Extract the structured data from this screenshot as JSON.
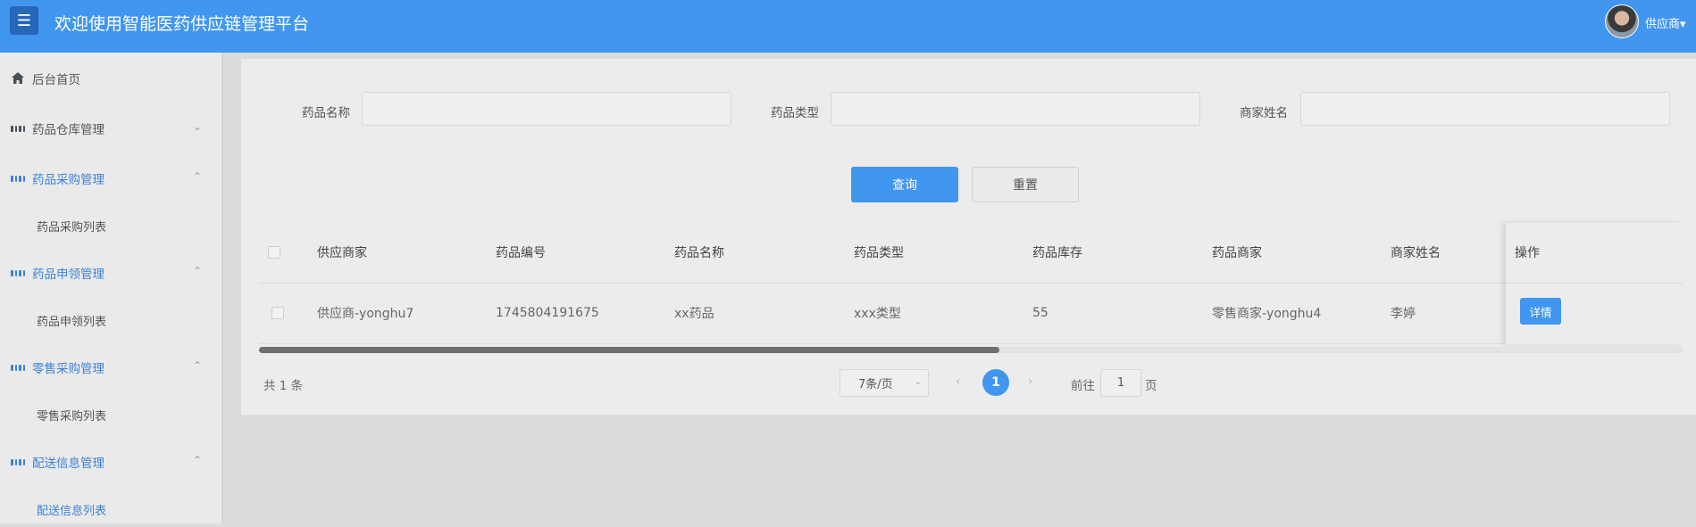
{
  "header": {
    "menu_icon": "hamburger-icon",
    "title": "欢迎使用智能医药供应链管理平台",
    "user_name": "供应商",
    "user_chevron": "▾",
    "menu_glyph": "☰"
  },
  "sidebar": {
    "items": [
      {
        "label": "后台首页",
        "icon": "home-icon"
      },
      {
        "label": "药品仓库管理",
        "icon": "grid-icon",
        "chevron": "⌄"
      },
      {
        "label": "药品采购管理",
        "icon": "grid-icon",
        "chevron": "⌃"
      },
      {
        "label": "药品采购列表"
      },
      {
        "label": "药品申领管理",
        "icon": "grid-icon",
        "chevron": "⌃"
      },
      {
        "label": "药品申领列表"
      },
      {
        "label": "零售采购管理",
        "icon": "grid-icon",
        "chevron": "⌃"
      },
      {
        "label": "零售采购列表"
      },
      {
        "label": "配送信息管理",
        "icon": "grid-icon",
        "chevron": "⌃"
      },
      {
        "label": "配送信息列表"
      }
    ]
  },
  "search": {
    "fields": [
      {
        "label": "药品名称",
        "value": "",
        "placeholder": ""
      },
      {
        "label": "药品类型",
        "value": "",
        "placeholder": ""
      },
      {
        "label": "商家姓名",
        "value": "",
        "placeholder": ""
      }
    ],
    "query_label": "查询",
    "reset_label": "重置"
  },
  "table": {
    "columns": [
      "供应商家",
      "药品编号",
      "药品名称",
      "药品类型",
      "药品库存",
      "药品商家",
      "商家姓名",
      "操作"
    ],
    "rows": [
      {
        "cells": [
          "供应商-yonghu7",
          "1745804191675",
          "xx药品",
          "xxx类型",
          "55",
          "零售商家-yonghu4",
          "李婷"
        ],
        "action_label": "详情"
      }
    ],
    "scroll_fraction": 0.52
  },
  "pagination": {
    "total_text": "共 1 条",
    "page_size_text": "7条/页",
    "prev": "‹",
    "next": "›",
    "current_page": "1",
    "goto_prefix": "前往",
    "goto_value": "1",
    "goto_suffix": "页"
  },
  "colors": {
    "primary": "#4196f0",
    "header_bg": "#4196f0",
    "menu_button": "#2767b8",
    "active_text": "#3b82d6"
  }
}
